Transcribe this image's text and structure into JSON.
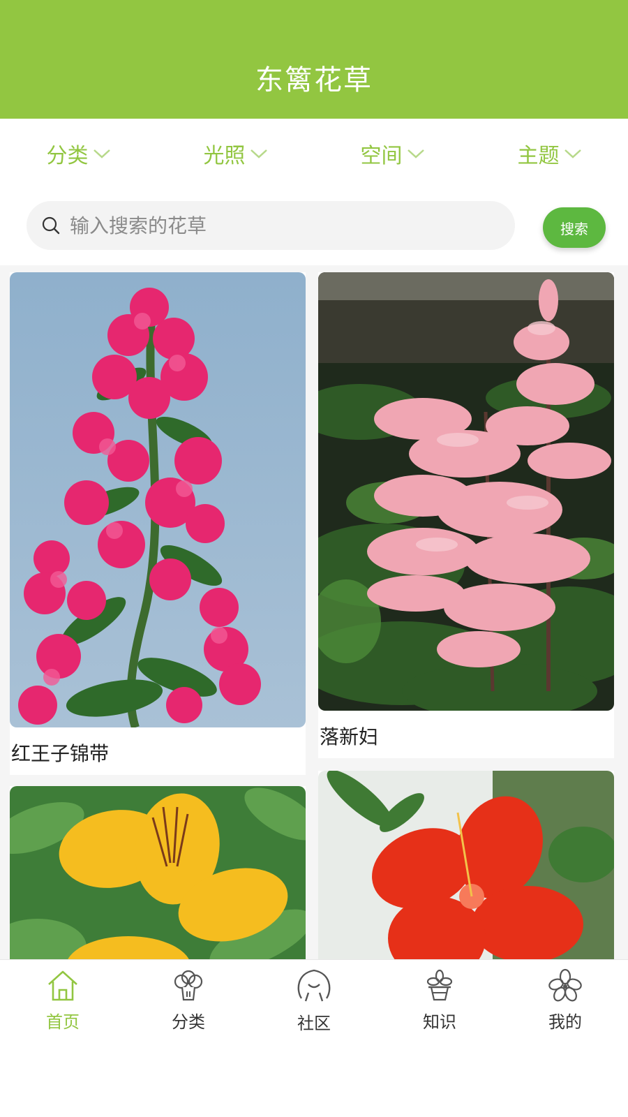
{
  "header": {
    "title": "东篱花草",
    "bg_color": "#92c641"
  },
  "filters": [
    {
      "label": "分类"
    },
    {
      "label": "光照"
    },
    {
      "label": "空间"
    },
    {
      "label": "主题"
    }
  ],
  "search": {
    "placeholder": "输入搜索的花草",
    "value": "",
    "button_label": "搜索"
  },
  "plants": [
    {
      "name": "红王子锦带"
    },
    {
      "name": "落新妇"
    },
    {
      "name": ""
    },
    {
      "name": ""
    }
  ],
  "tabbar": {
    "active": "首页",
    "items": [
      {
        "label": "首页",
        "icon": "home-icon"
      },
      {
        "label": "分类",
        "icon": "category-icon"
      },
      {
        "label": "社区",
        "icon": "community-icon"
      },
      {
        "label": "知识",
        "icon": "knowledge-icon"
      },
      {
        "label": "我的",
        "icon": "profile-icon"
      }
    ]
  },
  "colors": {
    "accent": "#92c641",
    "button": "#5db840"
  }
}
